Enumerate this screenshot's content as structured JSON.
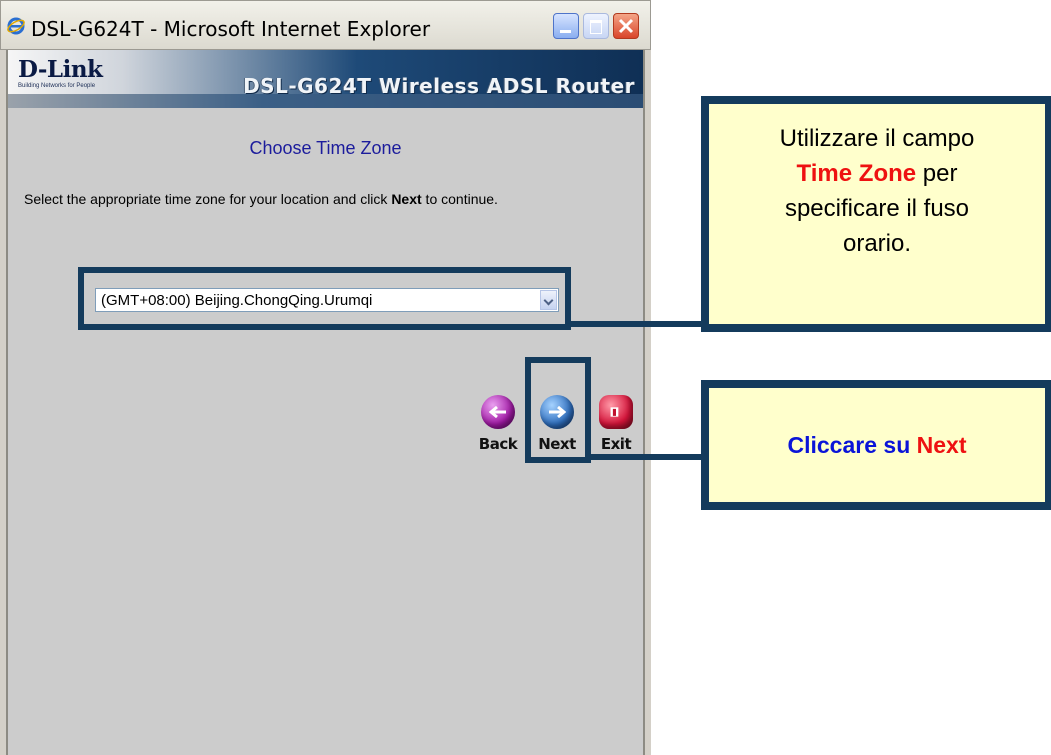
{
  "window": {
    "title": "DSL-G624T - Microsoft Internet Explorer"
  },
  "banner": {
    "logo": "D-Link",
    "logo_tagline": "Building Networks for People",
    "model": "DSL-G624T Wireless ADSL Router"
  },
  "page": {
    "title": "Choose Time Zone",
    "instruction_pre": "Select the appropriate time zone for your location and click ",
    "instruction_bold": "Next",
    "instruction_post": " to continue."
  },
  "timezone_select": {
    "selected": "(GMT+08:00) Beijing.ChongQing.Urumqi"
  },
  "nav": {
    "back": "Back",
    "next": "Next",
    "exit": "Exit"
  },
  "callouts": {
    "first": {
      "line1": "Utilizzare il campo",
      "highlight": "Time Zone",
      "after_highlight": " per",
      "line3": "specificare il fuso",
      "line4": "orario."
    },
    "second": {
      "pre": "Cliccare su ",
      "highlight": "Next"
    }
  },
  "colors": {
    "callout_border": "#143b5c",
    "callout_fill": "#ffffcc",
    "highlight_red": "#ee1111",
    "callout_blue": "#0a14d8",
    "page_title": "#1c1c9c"
  },
  "icons": [
    "ie-icon",
    "minimize-icon",
    "maximize-icon",
    "close-icon",
    "back-arrow-icon",
    "next-arrow-icon",
    "exit-door-icon"
  ]
}
